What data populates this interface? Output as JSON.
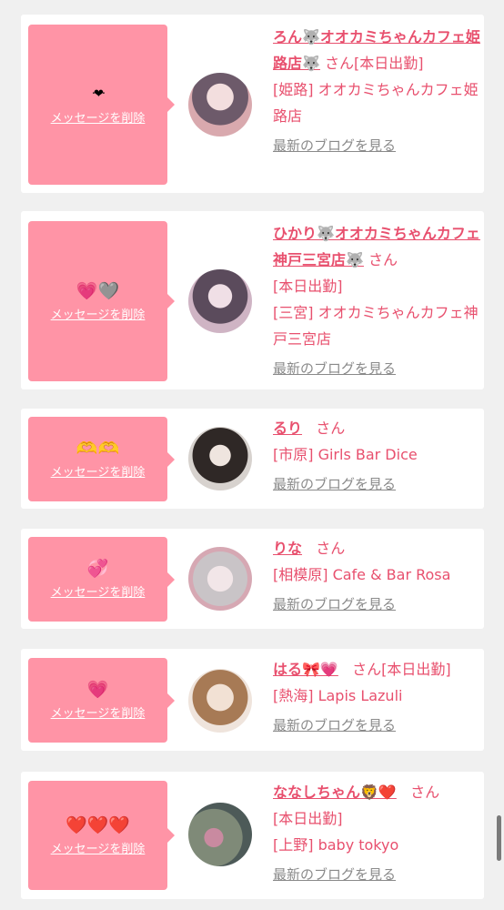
{
  "messages": [
    {
      "emoji": "·❤·",
      "delete_label": "メッセージを削除",
      "name": "ろん🐺オオカミちゃんカフェ姫路店🐺",
      "honorific": "さん",
      "status": "[本日出勤]",
      "shop": "[姫路] オオカミちゃんカフェ姫路店",
      "blog_link": "最新のブログを見る",
      "avatar_colors": [
        "#e9c7c9",
        "#7a6b78",
        "#d9a9ae"
      ]
    },
    {
      "emoji": "💗🩶",
      "delete_label": "メッセージを削除",
      "name": "ひかり🐺オオカミちゃんカフェ神戸三宮店🐺",
      "honorific": "さん",
      "status": "[本日出勤]",
      "shop": "[三宮] オオカミちゃんカフェ神戸三宮店",
      "blog_link": "最新のブログを見る",
      "avatar_colors": [
        "#d8b8c8",
        "#5b4b5c",
        "#e6ccd6"
      ]
    },
    {
      "emoji": "🫶🫶",
      "delete_label": "メッセージを削除",
      "name": "るり",
      "honorific": "さん",
      "status": "",
      "shop": "[市原] Girls Bar Dice",
      "blog_link": "最新のブログを見る",
      "avatar_colors": [
        "#d9d4d0",
        "#3a3230",
        "#efe7e2"
      ]
    },
    {
      "emoji": "💞",
      "delete_label": "メッセージを削除",
      "name": "りな",
      "honorific": "さん",
      "status": "",
      "shop": "[相模原] Cafe & Bar Rosa",
      "blog_link": "最新のブログを見る",
      "avatar_colors": [
        "#e9d6d8",
        "#c8c3c6",
        "#d6a8b3"
      ]
    },
    {
      "emoji": "💗",
      "delete_label": "メッセージを削除",
      "name": "はる🎀💗",
      "honorific": "さん",
      "status": "[本日出勤]",
      "shop": "[熱海] Lapis Lazuli",
      "blog_link": "最新のブログを見る",
      "avatar_colors": [
        "#ead9cc",
        "#a77a55",
        "#f0e4dc"
      ]
    },
    {
      "emoji": "❤️❤️❤️",
      "delete_label": "メッセージを削除",
      "name": "ななしちゃん🦁❤️",
      "honorific": "さん",
      "status": "[本日出勤]",
      "shop": "[上野] baby tokyo",
      "blog_link": "最新のブログを見る",
      "avatar_colors": [
        "#7f8a78",
        "#c98aa0",
        "#4d5a58"
      ]
    }
  ]
}
